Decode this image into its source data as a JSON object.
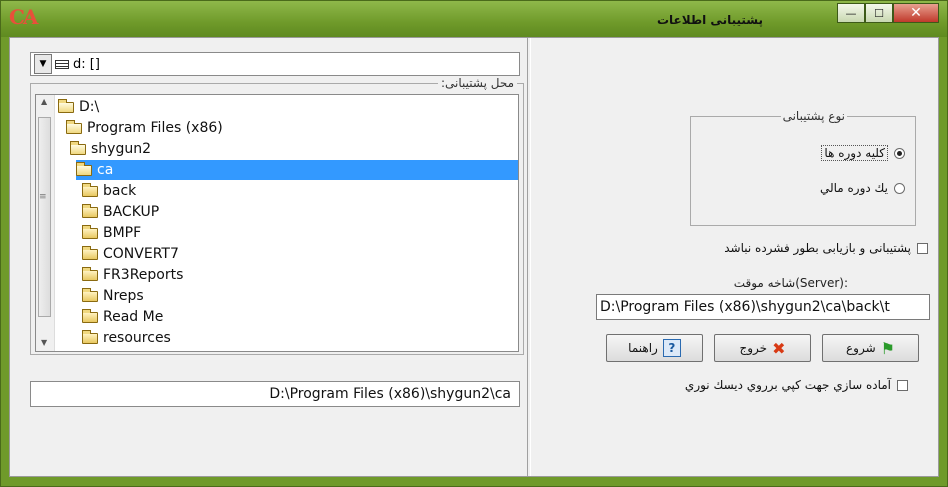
{
  "window": {
    "title": "پشتیبانی اطلاعات",
    "logo": "CA",
    "controls": {
      "minimize": "—",
      "maximize": "☐",
      "close": "✕"
    }
  },
  "drive": {
    "value": "d: []"
  },
  "folder_group": {
    "legend": "محل پشتیبانی:"
  },
  "tree": {
    "nodes": [
      {
        "label": "D:\\",
        "icon": "open-folder-icon",
        "selected": false
      },
      {
        "label": "Program Files (x86)",
        "icon": "open-folder-icon",
        "selected": false
      },
      {
        "label": "shygun2",
        "icon": "open-folder-icon",
        "selected": false
      },
      {
        "label": "ca",
        "icon": "open-folder-icon",
        "selected": true
      },
      {
        "label": "back",
        "icon": "folder-icon",
        "selected": false
      },
      {
        "label": "BACKUP",
        "icon": "folder-icon",
        "selected": false
      },
      {
        "label": "BMPF",
        "icon": "folder-icon",
        "selected": false
      },
      {
        "label": "CONVERT7",
        "icon": "folder-icon",
        "selected": false
      },
      {
        "label": "FR3Reports",
        "icon": "folder-icon",
        "selected": false
      },
      {
        "label": "Nreps",
        "icon": "folder-icon",
        "selected": false
      },
      {
        "label": "Read Me",
        "icon": "folder-icon",
        "selected": false
      },
      {
        "label": "resources",
        "icon": "folder-icon",
        "selected": false
      }
    ]
  },
  "selected_path": "D:\\Program Files (x86)\\shygun2\\ca",
  "backup_type": {
    "legend": "نوع پشتیبانی",
    "options": [
      {
        "label": "کلیه دوره ها",
        "checked": true
      },
      {
        "label": "یك دوره مالي",
        "checked": false
      }
    ]
  },
  "no_compress": {
    "label": "پشتیبانی و بازیابی بطور فشرده نباشد",
    "checked": false
  },
  "temp_folder": {
    "label": "شاخه موقت(Server):",
    "value": "D:\\Program Files (x86)\\shygun2\\ca\\back\\t"
  },
  "buttons": {
    "start": "شروع",
    "exit": "خروج",
    "help": "راهنما"
  },
  "cd_prepare": {
    "label": "آماده سازي جهت كپي برروي ديسك نوري",
    "checked": false
  },
  "colors": {
    "titlebar": "#6f9a2a",
    "selection": "#3399ff"
  }
}
